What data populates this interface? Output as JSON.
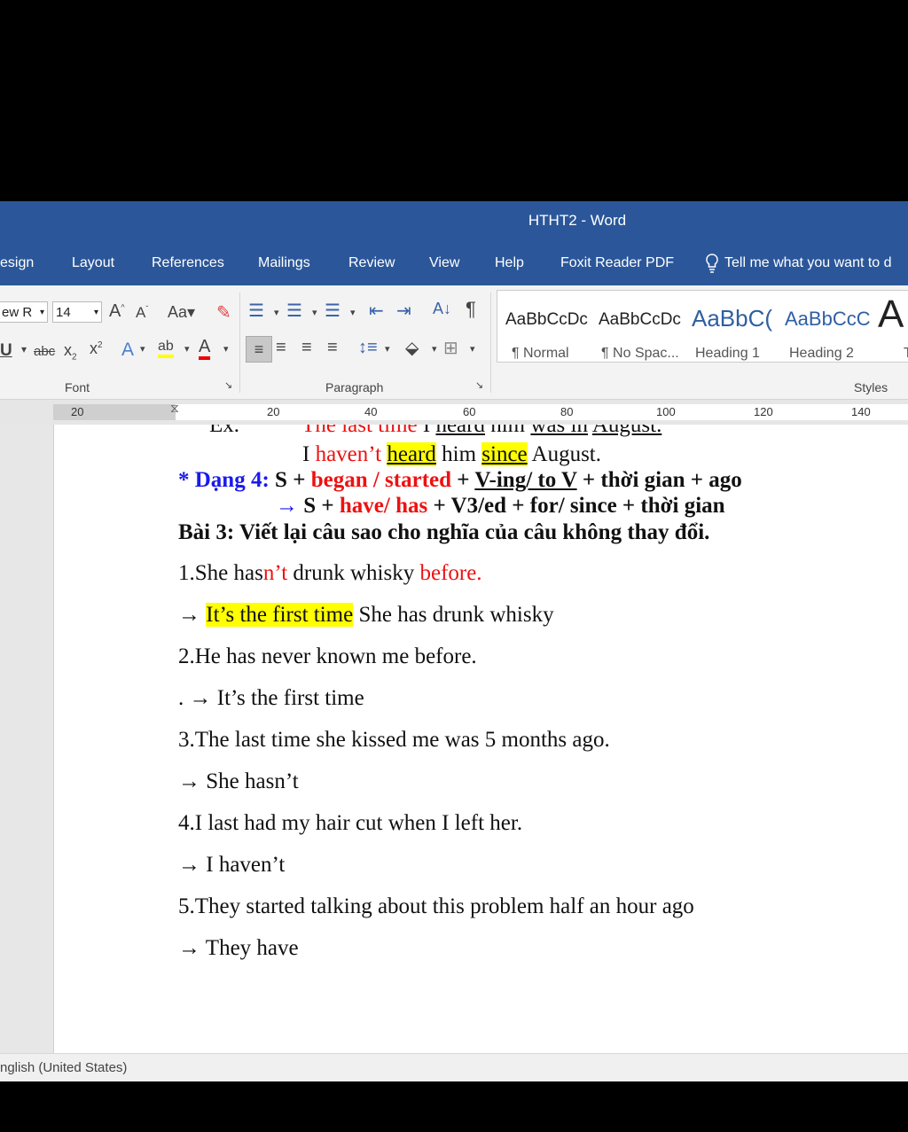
{
  "window": {
    "title": "HTHT2  -  Word"
  },
  "tabs": [
    "esign",
    "Layout",
    "References",
    "Mailings",
    "Review",
    "View",
    "Help",
    "Foxit Reader PDF"
  ],
  "tell_me": "Tell me what you want to d",
  "ribbon": {
    "font_name": "ew R",
    "font_size": "14",
    "groups": {
      "font": "Font",
      "paragraph": "Paragraph",
      "styles": "Styles"
    },
    "styles": [
      {
        "preview": "AaBbCcDc",
        "name": "¶ Normal"
      },
      {
        "preview": "AaBbCcDc",
        "name": "¶ No Spac..."
      },
      {
        "preview": "AaBbC(",
        "name": "Heading 1"
      },
      {
        "preview": "AaBbCcC",
        "name": "Heading 2"
      },
      {
        "preview": "A",
        "name": "T"
      }
    ]
  },
  "ruler": {
    "labels": [
      "20",
      "20",
      "40",
      "60",
      "80",
      "100",
      "120",
      "140"
    ]
  },
  "document": {
    "ex_cut": {
      "prefix": "Ex.",
      "a": "The last time",
      "b": "I",
      "c": "heard",
      "d": "him",
      "e": "was in",
      "f": "August."
    },
    "ex2": {
      "a": "I ",
      "b": "haven’t ",
      "c": "heard",
      "d": " him ",
      "e": "since",
      "f": " August."
    },
    "dang4": {
      "a": "* Dạng 4: ",
      "b": "S + ",
      "c": "began / started",
      "d": " + ",
      "e": "V-ing/ to V",
      "f": " + thời gian + ago"
    },
    "dang4b": {
      "arrow": "→",
      "a": " S + ",
      "b": "have/ has",
      "c": " + V3/ed + for/ since + thời gian"
    },
    "bai3": "Bài 3: Viết lại câu sao cho nghĩa của câu không thay đổi.",
    "q1": {
      "a": "1.She has",
      "b": "n’t",
      "c": " drunk whisky ",
      "d": "before."
    },
    "a1": {
      "arrow": "→",
      "a": "It’s the first time",
      "b": " She has drunk whisky"
    },
    "q2": "2.He has never known me before.",
    "a2": ". → It’s the first time",
    "q3": "3.The last time she kissed me was 5 months ago.",
    "a3": "→ She hasn’t",
    "q4": "4.I last had my hair cut when I left her.",
    "a4": "→ I haven’t",
    "q5": "5.They started talking about this problem half an hour ago",
    "a5": "→ They have"
  },
  "status": {
    "language": "nglish (United States)"
  }
}
